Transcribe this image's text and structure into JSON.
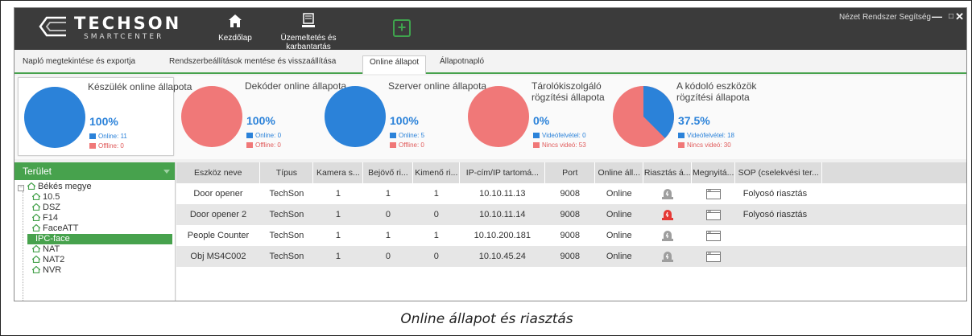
{
  "app": {
    "logo_text": "TECHSON",
    "logo_sub": "SMARTCENTER",
    "nav": [
      {
        "label": "Kezdőlap",
        "icon": "home-icon"
      },
      {
        "label": "Üzemeltetés és karbantartás",
        "icon": "monitor-icon"
      }
    ],
    "add_icon": "plus-icon",
    "menu_right": "Nézet  Rendszer  Segítség",
    "window_controls": {
      "minimize": "—",
      "maximize": "□",
      "close": "✕"
    }
  },
  "subtabs": [
    "Napló megtekintése és exportja",
    "Rendszerbeállítások mentése és visszaállítása",
    "Online állapot",
    "Állapotnapló"
  ],
  "active_subtab": "Online állapot",
  "cards": [
    {
      "title": "Készülék online állapota",
      "percent": "100%",
      "legend1": "Online: 11",
      "legend2": "Offline: 0",
      "blue_fraction": 1.0
    },
    {
      "title": "Dekóder online állapota",
      "percent": "100%",
      "legend1": "Online: 0",
      "legend2": "Offline: 0",
      "blue_fraction": 0.0
    },
    {
      "title": "Szerver online állapota",
      "percent": "100%",
      "legend1": "Online: 5",
      "legend2": "Offline: 0",
      "blue_fraction": 1.0
    },
    {
      "title": "Tárolókiszolgáló rögzítési állapota",
      "percent": "0%",
      "legend1": "Videófelvétel: 0",
      "legend2": "Nincs videó: 53",
      "blue_fraction": 0.0
    },
    {
      "title": "A kódoló eszközök rögzítési állapota",
      "percent": "37.5%",
      "legend1": "Videófelvétel: 18",
      "legend2": "Nincs videó: 30",
      "blue_fraction": 0.375
    }
  ],
  "colors": {
    "accent_green": "#47a24d",
    "blue": "#2b82d9",
    "red": "#f07878",
    "alarm_red": "#e53935",
    "alarm_gray": "#9e9e9e"
  },
  "tree": {
    "header": "Terület",
    "root": "Békés megye",
    "children": [
      "10.5",
      "DSZ",
      "F14",
      "FaceATT",
      "IPC-face",
      "NAT",
      "NAT2",
      "NVR"
    ],
    "selected": "IPC-face"
  },
  "table": {
    "headers": [
      "Eszköz neve",
      "Típus",
      "Kamera s...",
      "Bejövő ri...",
      "Kimenő ri...",
      "IP-cím/IP tartomá...",
      "Port",
      "Online áll...",
      "Riasztás á...",
      "Megnyitá...",
      "SOP (cselekvési ter..."
    ],
    "rows": [
      {
        "name": "Door opener",
        "type": "TechSon",
        "cam": "1",
        "in": "1",
        "out": "1",
        "ip": "10.10.11.13",
        "port": "9008",
        "online": "Online",
        "alarm": "gray",
        "sop": "Folyosó riasztás"
      },
      {
        "name": "Door opener 2",
        "type": "TechSon",
        "cam": "1",
        "in": "0",
        "out": "0",
        "ip": "10.10.11.14",
        "port": "9008",
        "online": "Online",
        "alarm": "red",
        "sop": "Folyosó riasztás"
      },
      {
        "name": "People Counter",
        "type": "TechSon",
        "cam": "1",
        "in": "1",
        "out": "1",
        "ip": "10.10.200.181",
        "port": "9008",
        "online": "Online",
        "alarm": "gray",
        "sop": ""
      },
      {
        "name": "Obj MS4C002",
        "type": "TechSon",
        "cam": "1",
        "in": "0",
        "out": "0",
        "ip": "10.10.45.24",
        "port": "9008",
        "online": "Online",
        "alarm": "gray",
        "sop": ""
      }
    ]
  },
  "caption": "Online állapot és riasztás"
}
